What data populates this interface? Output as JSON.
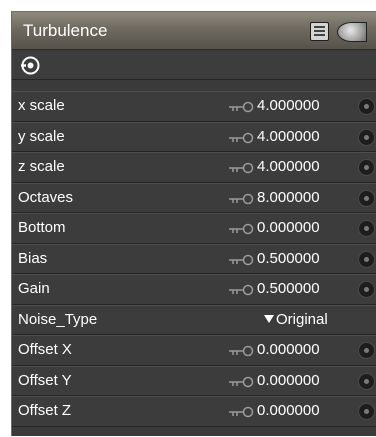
{
  "panel": {
    "title": "Turbulence"
  },
  "header_icons": {
    "doc": "document-icon",
    "render": "render-preview-icon"
  },
  "node_icon": "node-connect-icon",
  "params": [
    {
      "label": "x scale",
      "value": "4.000000",
      "type": "numeric"
    },
    {
      "label": "y scale",
      "value": "4.000000",
      "type": "numeric"
    },
    {
      "label": "z scale",
      "value": "4.000000",
      "type": "numeric"
    },
    {
      "label": "Octaves",
      "value": "8.000000",
      "type": "numeric"
    },
    {
      "label": "Bottom",
      "value": "0.000000",
      "type": "numeric"
    },
    {
      "label": "Bias",
      "value": "0.500000",
      "type": "numeric"
    },
    {
      "label": "Gain",
      "value": "0.500000",
      "type": "numeric"
    },
    {
      "label": "Noise_Type",
      "value": "Original",
      "type": "dropdown"
    },
    {
      "label": "Offset X",
      "value": "0.000000",
      "type": "numeric"
    },
    {
      "label": "Offset Y",
      "value": "0.000000",
      "type": "numeric"
    },
    {
      "label": "Offset Z",
      "value": "0.000000",
      "type": "numeric"
    }
  ]
}
